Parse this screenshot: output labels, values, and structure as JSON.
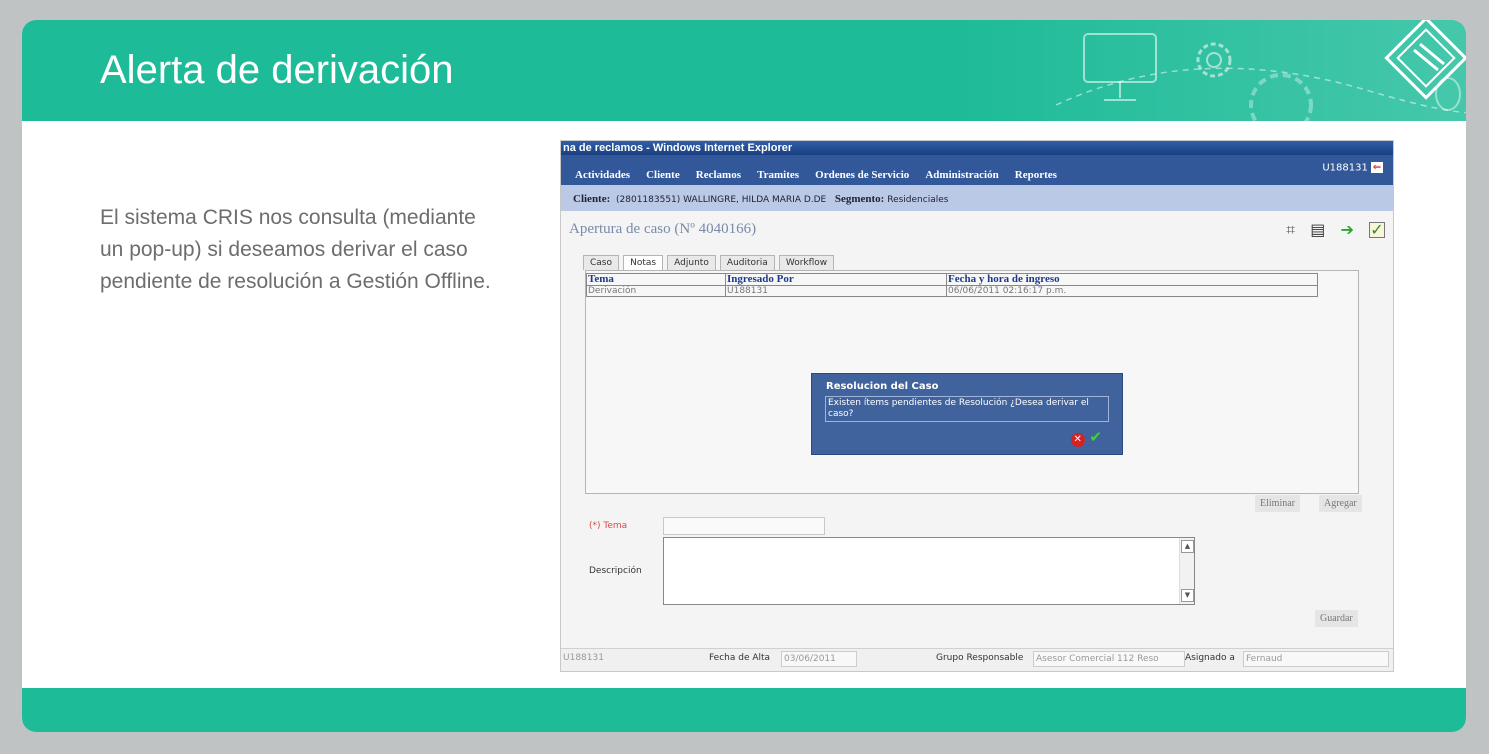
{
  "slide": {
    "title": "Alerta de derivación",
    "body": "El sistema CRIS nos consulta (mediante un pop-up) si deseamos derivar el caso pendiente de resolución a Gestión Offline."
  },
  "screenshot": {
    "window_title": "na de reclamos - Windows Internet Explorer",
    "menu": [
      "Actividades",
      "Cliente",
      "Reclamos",
      "Tramites",
      "Ordenes de Servicio",
      "Administración",
      "Reportes"
    ],
    "user": "U188131",
    "client_label": "Cliente:",
    "client_value": "(2801183551) WALLINGRE, HILDA MARIA D.DE",
    "segment_label": "Segmento:",
    "segment_value": "Residenciales",
    "case_title": "Apertura de caso (Nº 4040166)",
    "tabs": [
      "Caso",
      "Notas",
      "Adjunto",
      "Auditoria",
      "Workflow"
    ],
    "table": {
      "headers": [
        "Tema",
        "Ingresado Por",
        "Fecha y hora de ingreso"
      ],
      "rows": [
        [
          "Derivación",
          "U188131",
          "06/06/2011 02:16:17 p.m."
        ]
      ]
    },
    "popup": {
      "title": "Resolucion del Caso",
      "message": "Existen ítems pendientes de Resolución ¿Desea derivar el caso?"
    },
    "buttons": {
      "eliminar": "Eliminar",
      "agregar": "Agregar",
      "guardar": "Guardar"
    },
    "form": {
      "tema_label": "(*) Tema",
      "descripcion_label": "Descripción"
    },
    "status": {
      "user": "U188131",
      "fecha_alta_label": "Fecha de Alta",
      "fecha_alta_value": "03/06/2011",
      "grupo_label": "Grupo Responsable",
      "grupo_value": "Asesor Comercial 112 Reso",
      "asignado_label": "Asignado a",
      "asignado_value": "Fernaud"
    }
  }
}
